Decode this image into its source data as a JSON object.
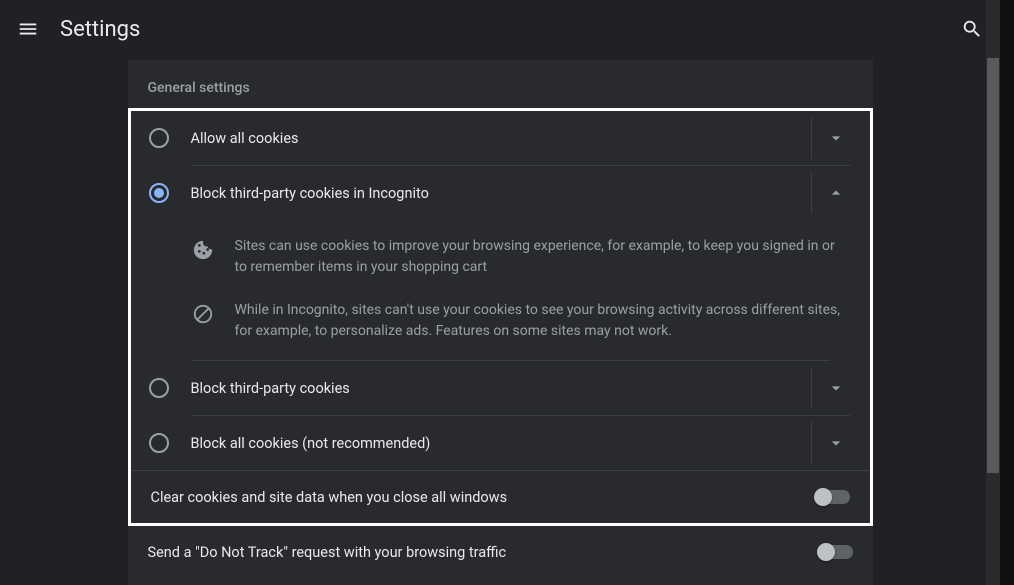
{
  "header": {
    "title": "Settings"
  },
  "section": {
    "title": "General settings"
  },
  "options": [
    {
      "label": "Allow all cookies",
      "selected": false,
      "expanded": false
    },
    {
      "label": "Block third-party cookies in Incognito",
      "selected": true,
      "expanded": true
    },
    {
      "label": "Block third-party cookies",
      "selected": false,
      "expanded": false
    },
    {
      "label": "Block all cookies (not recommended)",
      "selected": false,
      "expanded": false
    }
  ],
  "details": {
    "info1": "Sites can use cookies to improve your browsing experience, for example, to keep you signed in or to remember items in your shopping cart",
    "info2": "While in Incognito, sites can't use your cookies to see your browsing activity across different sites, for example, to personalize ads. Features on some sites may not work."
  },
  "toggles": {
    "clear_on_close": "Clear cookies and site data when you close all windows",
    "do_not_track": "Send a \"Do Not Track\" request with your browsing traffic"
  }
}
